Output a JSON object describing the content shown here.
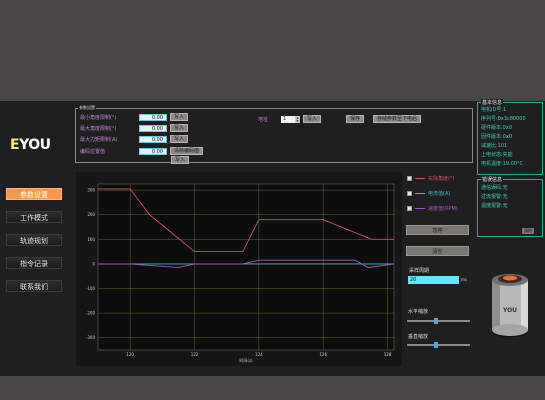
{
  "logo": {
    "text_a": "E",
    "text_b": "YOU"
  },
  "params": {
    "legend": "参数设置",
    "rows": [
      {
        "label": "最小角度限制(°)",
        "value": "0.00",
        "button": "写入"
      },
      {
        "label": "最大角度限制(°)",
        "value": "0.00",
        "button": "写入"
      },
      {
        "label": "最大力矩限制(A)",
        "value": "0.00",
        "button": "写入"
      },
      {
        "label": "编码位置值",
        "value": "0.00",
        "button": "清除编码值"
      }
    ],
    "extra_write": "写入",
    "id_label": "地址",
    "id_value": "1",
    "id_write": "写入",
    "save_button": "保存",
    "save_default": "存储参数至下电后"
  },
  "motor_info": {
    "legend": "基本信息",
    "lines": [
      "电机ID号:1",
      "序列号:0x3c80000",
      "硬件版本:0x0",
      "固件版本:0x0",
      "减速比:101",
      "上电状态:失能",
      "电机温度:19.00°C"
    ]
  },
  "error_info": {
    "legend": "错误信息",
    "lines": [
      "通信误码:无",
      "过流报警:无",
      "温度报警:无"
    ],
    "clear_button": "清除"
  },
  "sidebar": {
    "items": [
      {
        "label": "参数设置",
        "active": true
      },
      {
        "label": "工作模式",
        "active": false
      },
      {
        "label": "轨迹规划",
        "active": false
      },
      {
        "label": "指令记录",
        "active": false
      },
      {
        "label": "联系我们",
        "active": false
      }
    ]
  },
  "legend": [
    {
      "label": "实际角度(°)",
      "color": "#d94c6a"
    },
    {
      "label": "电流值(A)",
      "color": "#3fbfd0"
    },
    {
      "label": "速度值(RPM)",
      "color": "#b054c9"
    }
  ],
  "right_panel": {
    "pause_button": "暂停",
    "clear_button": "清空",
    "period_label": "采样周期",
    "period_value": "20",
    "period_unit": "ms",
    "hscale_label": "水平缩放",
    "hscale_level": 0.45,
    "vscale_label": "垂直缩放",
    "vscale_level": 0.45
  },
  "chart_data": {
    "type": "line",
    "xlabel": "时间(s)",
    "x_ticks": [
      "120",
      "122",
      "124",
      "126",
      "128"
    ],
    "y_ticks": [
      "300",
      "200",
      "100",
      "0",
      "-100",
      "-200",
      "-300"
    ],
    "xlim": [
      119,
      128.2
    ],
    "ylim": [
      -350,
      325
    ],
    "grid": true,
    "series": [
      {
        "color": "#d94c6a",
        "x": [
          119,
          120,
          120.6,
          122,
          123.5,
          124,
          125.5,
          126,
          127.5,
          128.2
        ],
        "y": [
          305,
          305,
          200,
          50,
          50,
          180,
          180,
          180,
          100,
          100
        ]
      },
      {
        "color": "#3fbfd0",
        "x": [
          119,
          128.2
        ],
        "y": [
          0,
          0
        ]
      },
      {
        "color": "#b054c9",
        "x": [
          119,
          120,
          121.5,
          122,
          123.5,
          124,
          127,
          127.4,
          128.2
        ],
        "y": [
          0,
          0,
          -15,
          0,
          0,
          15,
          15,
          -15,
          0
        ]
      }
    ]
  }
}
